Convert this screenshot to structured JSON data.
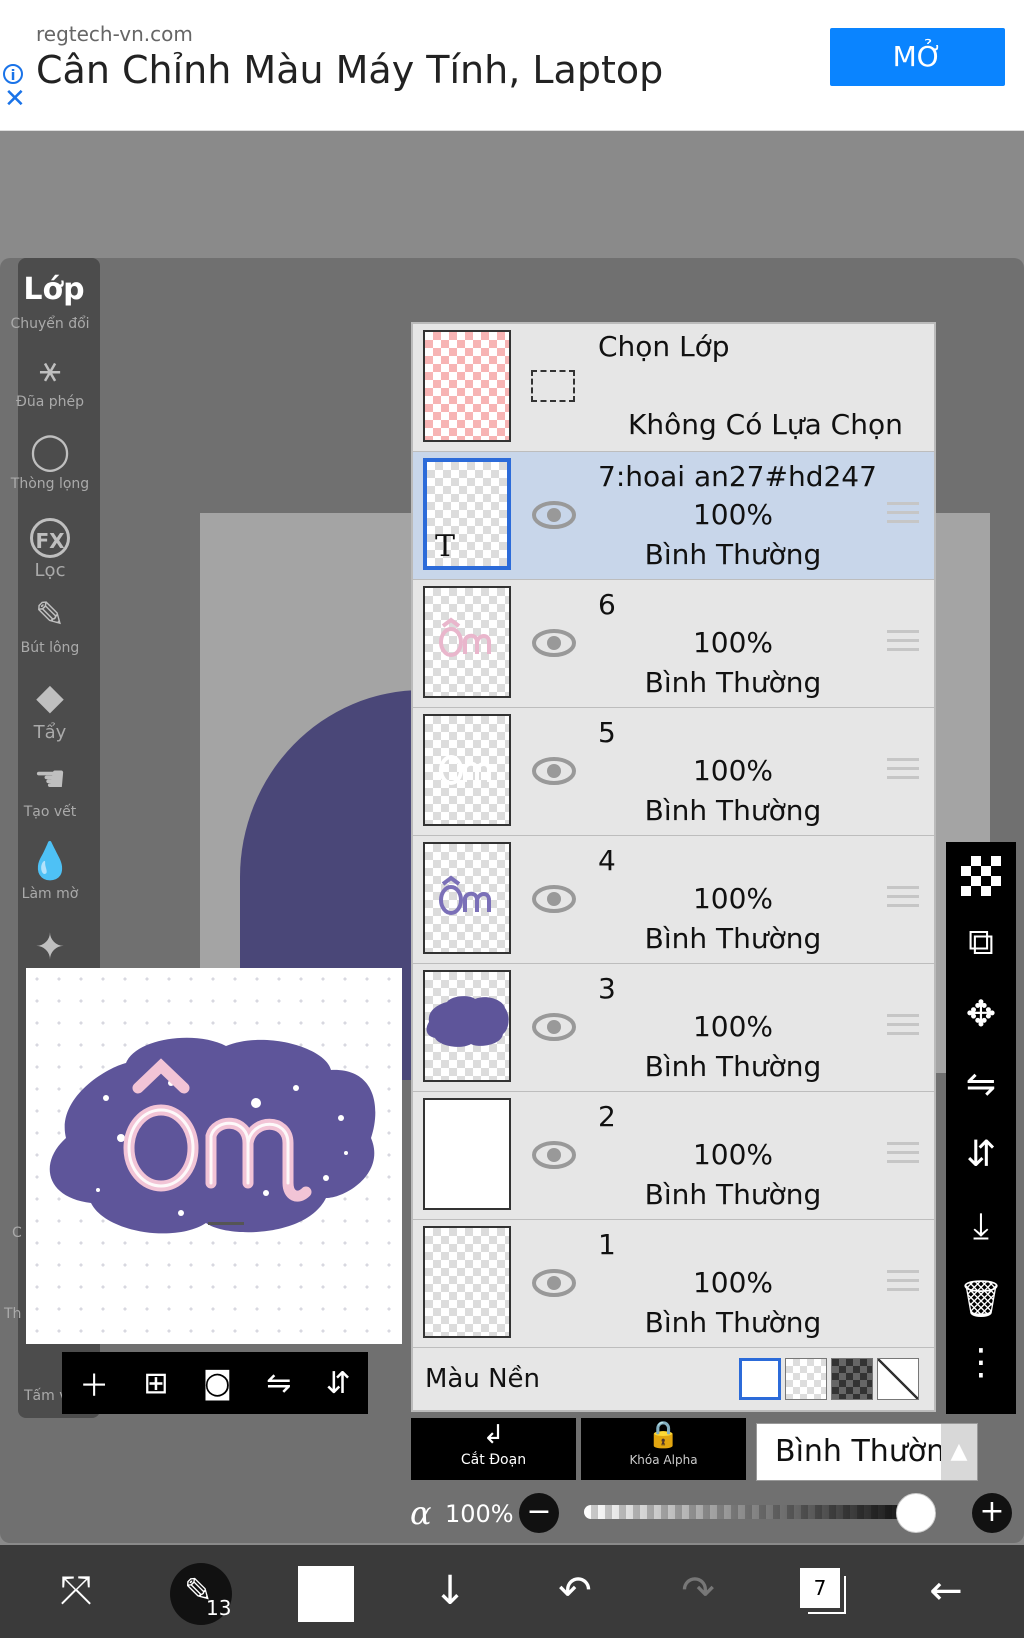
{
  "ad": {
    "domain": "regtech-vn.com",
    "title": "Cân Chỉnh Màu Máy Tính, Laptop",
    "button": "MỞ",
    "info_icon": "info-icon",
    "close_icon": "close-icon"
  },
  "sidebar": {
    "title": "Lớp",
    "tools": [
      {
        "label": "Chuyển đổi",
        "icon": "transform-icon"
      },
      {
        "label": "Đũa phép",
        "icon": "magic-wand-icon"
      },
      {
        "label": "Thòng lọng",
        "icon": "lasso-icon"
      },
      {
        "label": "Lọc",
        "icon": "fx-icon",
        "glyph": "FX"
      },
      {
        "label": "Bút lông",
        "icon": "brush-icon"
      },
      {
        "label": "Tẩy",
        "icon": "eraser-icon"
      },
      {
        "label": "Tạo vết",
        "icon": "smudge-icon"
      },
      {
        "label": "Làm mờ",
        "icon": "blur-icon"
      }
    ],
    "partial_labels": [
      "Th",
      "Tấm v",
      "C"
    ]
  },
  "preview_tools": [
    "add-layer-icon",
    "add-copy-icon",
    "camera-icon",
    "flip-horizontal-icon",
    "flip-vertical-icon"
  ],
  "layer_panel": {
    "selection": {
      "title": "Chọn Lớp",
      "status": "Không Có Lựa Chọn"
    },
    "layers": [
      {
        "name": "7:hoai an27#hd247",
        "opacity": "100%",
        "mode": "Bình Thường",
        "selected": true,
        "thumb": "text",
        "thumb_glyph": "T"
      },
      {
        "name": "6",
        "opacity": "100%",
        "mode": "Bình Thường",
        "selected": false,
        "thumb": "om-pink"
      },
      {
        "name": "5",
        "opacity": "100%",
        "mode": "Bình Thường",
        "selected": false,
        "thumb": "om-white"
      },
      {
        "name": "4",
        "opacity": "100%",
        "mode": "Bình Thường",
        "selected": false,
        "thumb": "om-purple"
      },
      {
        "name": "3",
        "opacity": "100%",
        "mode": "Bình Thường",
        "selected": false,
        "thumb": "blob-purple"
      },
      {
        "name": "2",
        "opacity": "100%",
        "mode": "Bình Thường",
        "selected": false,
        "thumb": "white"
      },
      {
        "name": "1",
        "opacity": "100%",
        "mode": "Bình Thường",
        "selected": false,
        "thumb": "empty"
      }
    ],
    "background": {
      "label": "Màu Nền",
      "options": [
        "white",
        "checker-light",
        "checker-dark",
        "none"
      ],
      "selected": "white"
    }
  },
  "right_toolbar": [
    "checkerboard-icon",
    "layer-transfer-icon",
    "move-icon",
    "flip-horizontal-icon",
    "flip-vertical-icon",
    "merge-down-icon",
    "trash-icon",
    "more-options-icon"
  ],
  "controls": {
    "clip_label": "Cắt Đoạn",
    "alpha_lock_label": "Khóa Alpha",
    "blend_mode": "Bình Thường",
    "alpha_symbol": "α",
    "opacity": "100%",
    "opacity_value": 1.0
  },
  "bottom_bar": {
    "brush_size": "13",
    "layer_count": "7",
    "primary_color": "#ffffff"
  },
  "colors": {
    "accent_blue": "#2c6bd9",
    "ad_button": "#0a84ff",
    "artwork_purple": "#5e559a",
    "artwork_pink": "#f2c4d6"
  }
}
